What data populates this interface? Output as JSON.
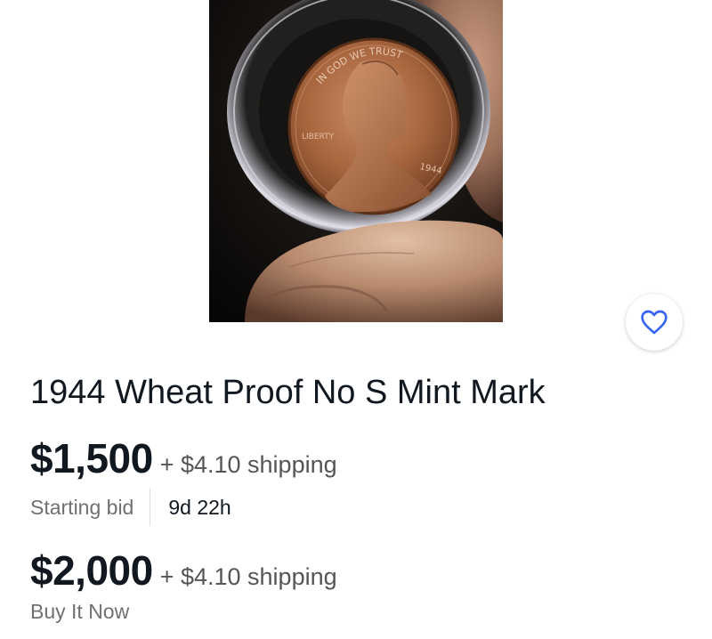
{
  "listing": {
    "title": "1944 Wheat Proof No S Mint Mark",
    "image_icon": "coin-photo",
    "coin_inscription_top": "IN GOD WE TRUST",
    "coin_inscription_left": "LIBERTY",
    "coin_year": "1944",
    "watch_icon": "heart-outline-icon",
    "accent_color": "#3665f3"
  },
  "auction": {
    "price": "$1,500",
    "shipping": "+ $4.10 shipping",
    "label": "Starting bid",
    "time_left": "9d 22h"
  },
  "buy_now": {
    "price": "$2,000",
    "shipping": "+ $4.10 shipping",
    "label": "Buy It Now"
  }
}
